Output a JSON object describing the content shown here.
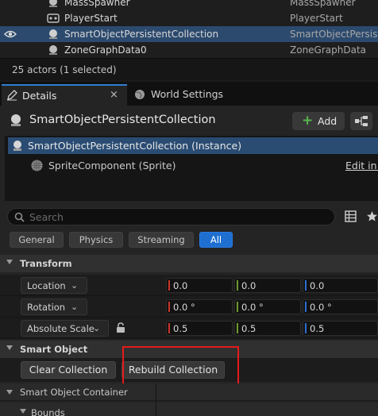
{
  "outliner": {
    "rows": [
      {
        "name": "MassSpawner",
        "type": "MassSpawner",
        "selected": false
      },
      {
        "name": "PlayerStart",
        "type": "PlayerStart",
        "selected": false
      },
      {
        "name": "SmartObjectPersistentCollection",
        "type": "SmartObjectPersist",
        "selected": true
      },
      {
        "name": "ZoneGraphData0",
        "type": "ZoneGraphData",
        "selected": false
      }
    ],
    "status": "25 actors (1 selected)"
  },
  "tabs": {
    "details": "Details",
    "world_settings": "World Settings",
    "close_glyph": "×"
  },
  "details": {
    "actor_name": "SmartObjectPersistentCollection",
    "add_label": "Add",
    "components": [
      {
        "label": "SmartObjectPersistentCollection (Instance)"
      },
      {
        "label": "SpriteComponent (Sprite)",
        "action": "Edit in C"
      }
    ],
    "search_placeholder": "Search",
    "filters": [
      "General",
      "Physics",
      "Streaming",
      "All"
    ],
    "active_filter": "All"
  },
  "transform": {
    "section_label": "Transform",
    "rows": [
      {
        "label": "Location",
        "x": "0.0",
        "y": "0.0",
        "z": "0.0"
      },
      {
        "label": "Rotation",
        "x": "0.0 °",
        "y": "0.0 °",
        "z": "0.0 °"
      },
      {
        "label": "Absolute Scale",
        "x": "0.5",
        "y": "0.5",
        "z": "0.5"
      }
    ]
  },
  "smart_object": {
    "section_label": "Smart Object",
    "clear_label": "Clear Collection",
    "rebuild_label": "Rebuild Collection",
    "container_label": "Smart Object Container",
    "bounds_label": "Bounds"
  },
  "colors": {
    "accent": "#1e6fd0",
    "selection": "#2c4a6e",
    "axis_x": "#c8352a",
    "axis_y": "#6f9a2c",
    "axis_z": "#2d6ecf",
    "highlight_box": "#e51b1b"
  }
}
